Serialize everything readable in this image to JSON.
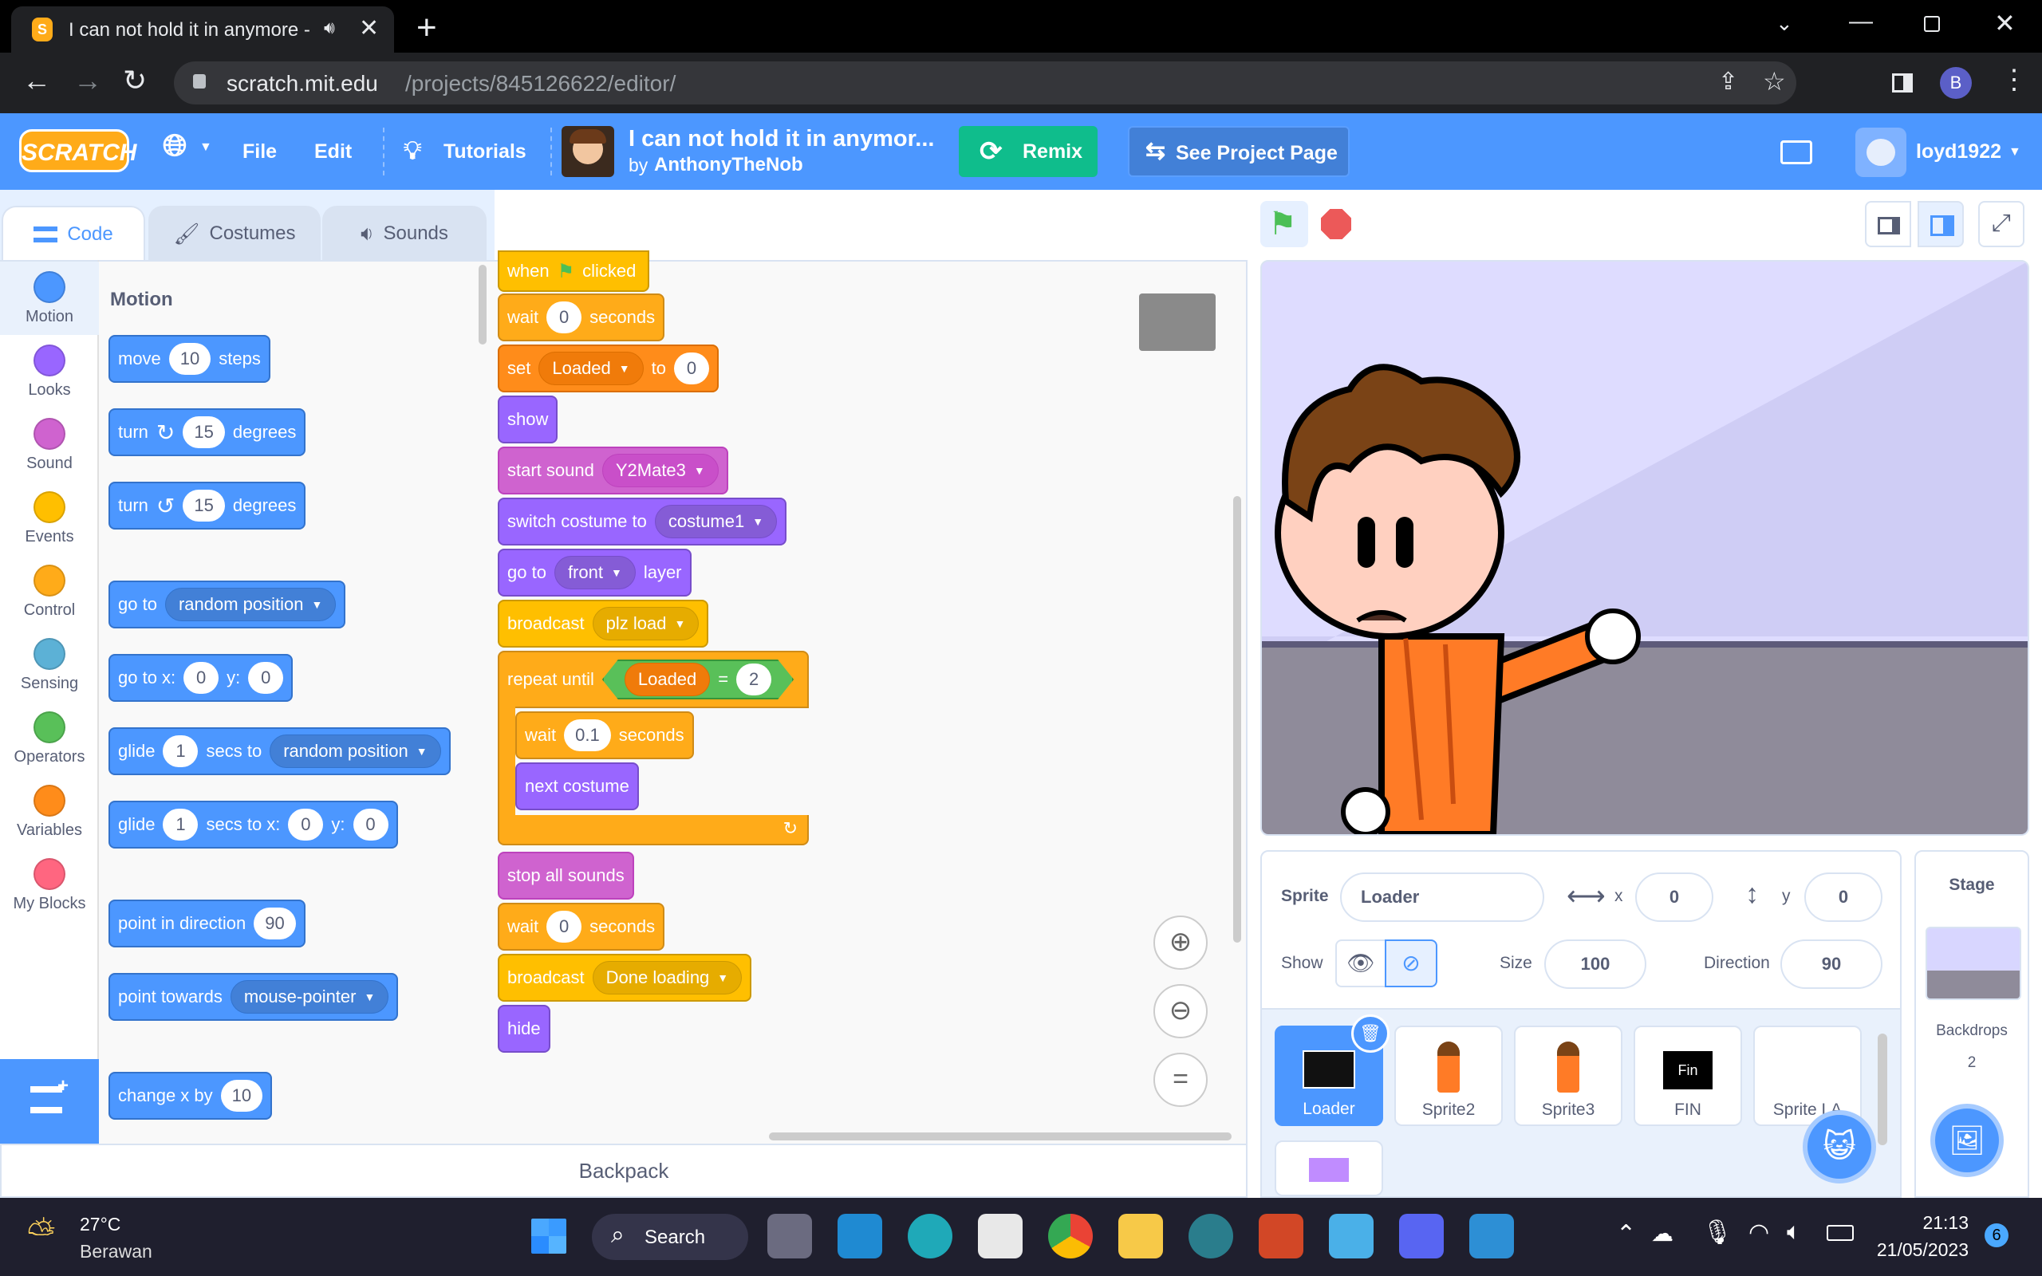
{
  "browser": {
    "tab_title": "I can not hold it in anymore -",
    "new_tab": "+",
    "url_host": "scratch.mit.edu",
    "url_path": "/projects/845126622/editor/",
    "profile_initial": "B"
  },
  "menubar": {
    "logo": "SCRATCH",
    "file": "File",
    "edit": "Edit",
    "tutorials": "Tutorials",
    "project_title": "I can not hold it in anymor...",
    "by_label": "by",
    "author": "AnthonyTheNob",
    "remix": "Remix",
    "see_project_page": "See Project Page",
    "username": "loyd1922"
  },
  "editor_tabs": {
    "code": "Code",
    "costumes": "Costumes",
    "sounds": "Sounds"
  },
  "categories": [
    {
      "label": "Motion",
      "color": "#4c97ff"
    },
    {
      "label": "Looks",
      "color": "#9966ff"
    },
    {
      "label": "Sound",
      "color": "#cf63cf"
    },
    {
      "label": "Events",
      "color": "#ffbf00"
    },
    {
      "label": "Control",
      "color": "#ffab19"
    },
    {
      "label": "Sensing",
      "color": "#5cb1d6"
    },
    {
      "label": "Operators",
      "color": "#59c059"
    },
    {
      "label": "Variables",
      "color": "#ff8c1a"
    },
    {
      "label": "My Blocks",
      "color": "#ff6680"
    }
  ],
  "palette": {
    "heading": "Motion",
    "move": {
      "a": "move",
      "v": "10",
      "b": "steps"
    },
    "turn_right": {
      "a": "turn",
      "v": "15",
      "b": "degrees"
    },
    "turn_left": {
      "a": "turn",
      "v": "15",
      "b": "degrees"
    },
    "goto": {
      "a": "go to",
      "dd": "random position"
    },
    "gotoxy": {
      "a": "go to x:",
      "x": "0",
      "b": "y:",
      "y": "0"
    },
    "glide_to": {
      "a": "glide",
      "v": "1",
      "b": "secs to",
      "dd": "random position"
    },
    "glide_xy": {
      "a": "glide",
      "v": "1",
      "b": "secs to x:",
      "x": "0",
      "c": "y:",
      "y": "0"
    },
    "point_dir": {
      "a": "point in direction",
      "v": "90"
    },
    "point_towards": {
      "a": "point towards",
      "dd": "mouse-pointer"
    },
    "change_x": {
      "a": "change x by",
      "v": "10"
    }
  },
  "script": {
    "hat_a": "when",
    "hat_b": "clicked",
    "wait1": {
      "a": "wait",
      "v": "0",
      "b": "seconds"
    },
    "set": {
      "a": "set",
      "dd": "Loaded",
      "b": "to",
      "v": "0"
    },
    "show": "show",
    "start_sound": {
      "a": "start sound",
      "dd": "Y2Mate3"
    },
    "switch_costume": {
      "a": "switch costume to",
      "dd": "costume1"
    },
    "goto_layer": {
      "a": "go to",
      "dd": "front",
      "b": "layer"
    },
    "broadcast1": {
      "a": "broadcast",
      "dd": "plz load"
    },
    "repeat_until": {
      "a": "repeat until",
      "var": "Loaded",
      "op": "=",
      "v": "2"
    },
    "wait_inner": {
      "a": "wait",
      "v": "0.1",
      "b": "seconds"
    },
    "next_costume": "next costume",
    "stop_sounds": "stop all sounds",
    "wait2": {
      "a": "wait",
      "v": "0",
      "b": "seconds"
    },
    "broadcast2": {
      "a": "broadcast",
      "dd": "Done loading"
    },
    "hide": "hide"
  },
  "sprite_info": {
    "sprite_label": "Sprite",
    "sprite_name": "Loader",
    "x_label": "x",
    "x": "0",
    "y_label": "y",
    "y": "0",
    "show_label": "Show",
    "size_label": "Size",
    "size": "100",
    "direction_label": "Direction",
    "direction": "90"
  },
  "sprites": [
    {
      "name": "Loader"
    },
    {
      "name": "Sprite2"
    },
    {
      "name": "Sprite3"
    },
    {
      "name": "FIN",
      "thumb_text": "Fin"
    },
    {
      "name": "Sprite LA"
    }
  ],
  "stage_panel": {
    "title": "Stage",
    "backdrops_label": "Backdrops",
    "backdrops_count": "2"
  },
  "backpack": "Backpack",
  "taskbar": {
    "temp": "27°C",
    "weather": "Berawan",
    "search": "Search",
    "time": "21:13",
    "date": "21/05/2023",
    "notif_count": "6"
  },
  "colors": {
    "scratch_blue": "#4c97ff",
    "remix_green": "#0fbd8c"
  }
}
